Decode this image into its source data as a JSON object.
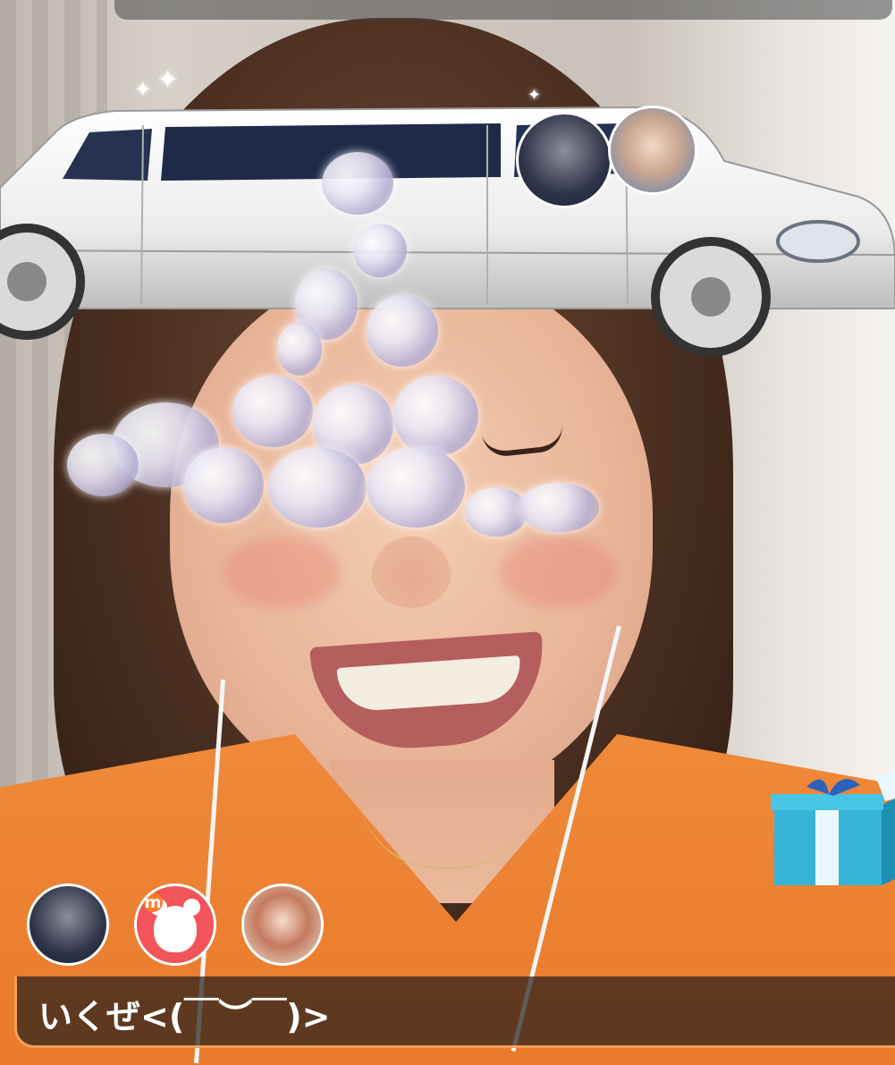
{
  "stream": {
    "comment": "いくぜ<(￣︶￣)>"
  },
  "top_avatars": [
    {
      "name": "anime-character-avatar"
    },
    {
      "name": "streamer-photo-avatar"
    }
  ],
  "bottom_avatars": [
    {
      "name": "anime-character-avatar"
    },
    {
      "name": "bear-mascot-avatar",
      "badge": "m"
    },
    {
      "name": "girl-photo-avatar"
    }
  ],
  "gift_effect": {
    "vehicle": "limousine",
    "color": "#ffffff"
  },
  "colors": {
    "accent": "#f4a05a",
    "shirt": "#f08a3a",
    "gift_box": "#36b4d8"
  }
}
